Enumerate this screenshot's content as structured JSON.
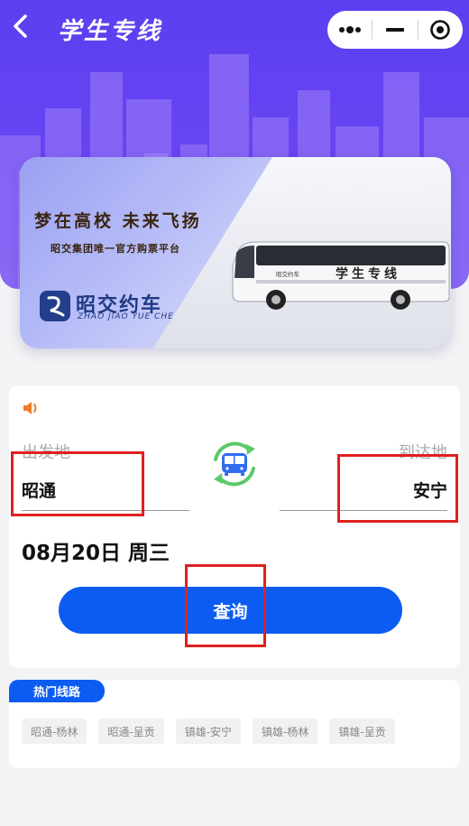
{
  "header": {
    "title": "学生专线"
  },
  "banner": {
    "slogan": "梦在高校 未来飞扬",
    "sub_slogan": "昭交集团唯一官方购票平台",
    "brand_name": "昭交约车",
    "brand_pinyin": "ZHAO JIAO YUE CHE",
    "bus_label": "学生专线",
    "bus_brand": "昭交约车"
  },
  "search": {
    "from_label": "出发地",
    "to_label": "到达地",
    "from_value": "昭通",
    "to_value": "安宁",
    "date": "08月20日 周三",
    "query_label": "查询"
  },
  "hot": {
    "title": "热门线路",
    "routes": [
      "昭通-杨林",
      "昭通-呈贡",
      "镇雄-安宁",
      "镇雄-杨林",
      "镇雄-呈贡"
    ]
  },
  "colors": {
    "primary": "#0d5cf2",
    "hero": "#5b3ff0",
    "annotation": "#e02020",
    "speaker": "#f07a2a",
    "swap_green": "#5cc96a"
  }
}
